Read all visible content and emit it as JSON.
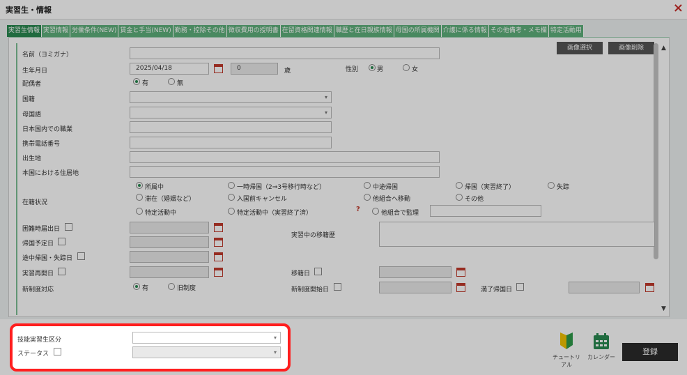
{
  "window": {
    "title": "実習生・情報",
    "close": "×"
  },
  "tabs": [
    "実習生情報",
    "実習情報",
    "労働条件(NEW)",
    "賃金と手当(NEW)",
    "勤務・控除その他",
    "徴収費用の授明書",
    "在留資格関連情報",
    "職歴と在日親族情報",
    "母国の所属機関",
    "介護に係る情報",
    "その他備考・メモ欄",
    "特定活動用"
  ],
  "photo": {
    "select": "画像選択",
    "delete": "画像削除"
  },
  "labels": {
    "kana": "名前（ヨミガナ）",
    "birth": "生年月日",
    "age_unit": "歳",
    "gender": "性別",
    "male": "男",
    "female": "女",
    "spouse": "配偶者",
    "yes": "有",
    "no": "無",
    "nationality": "国籍",
    "language": "母国語",
    "job": "日本国内での職業",
    "phone": "携帯電話番号",
    "birthplace": "出生地",
    "home_address": "本国における住居地",
    "status_label": "在籍状況",
    "difficulty": "困難時届出日",
    "return_date": "帰国予定日",
    "midway": "途中帰国・失踪日",
    "restart": "実習再開日",
    "new_system": "新制度対応",
    "new": "有",
    "old": "旧制度",
    "transfer_history": "実習中の移籍歴",
    "transfer_date": "移籍日",
    "new_start": "新制度開始日",
    "full_return": "満了帰国日"
  },
  "values": {
    "birth": "2025/04/18",
    "age": "0"
  },
  "status_options": [
    "所属中",
    "一時帰国（2⇒3号移行時など）",
    "中途帰国",
    "帰国（実習終了）",
    "失踪",
    "滞在（婚姻など）",
    "入国前キャンセル",
    "他組合へ移動",
    "その他",
    "特定活動中",
    "特定活動中（実習終了済）",
    "他組合で監理"
  ],
  "help_mark": "?",
  "bottom": {
    "skill_class": "技能実習生区分",
    "status": "ステータス",
    "tutorial": "チュートリアル",
    "calendar": "カレンダー",
    "register": "登録"
  },
  "colors": {
    "accent": "#2a8a51",
    "tab": "#5eb07b",
    "highlight": "#ff1e1e"
  }
}
